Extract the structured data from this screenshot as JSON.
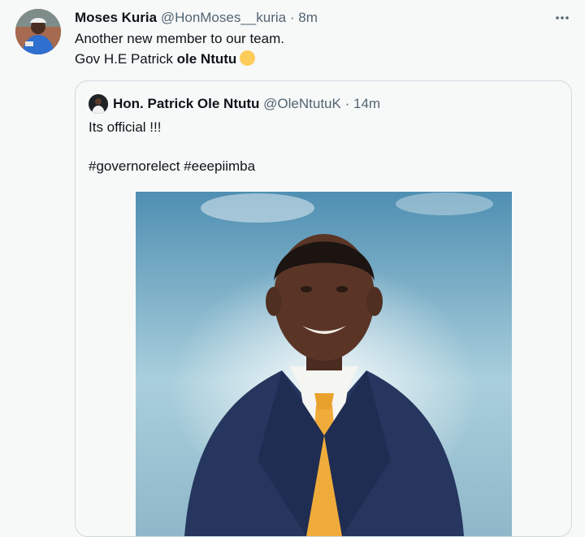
{
  "tweet": {
    "author_name": "Moses Kuria",
    "author_handle": "@HonMoses__kuria",
    "separator": "·",
    "time": "8m",
    "line1": "Another new member to our team.",
    "line2_prefix": "Gov H.E Patrick ",
    "line2_bold": "ole Ntutu",
    "emoji": "yellow-circle",
    "more_icon": "more-horizontal-icon"
  },
  "quoted": {
    "author_name": "Hon. Patrick Ole Ntutu",
    "author_handle": "@OleNtutuK",
    "separator": "·",
    "time": "14m",
    "text1": "Its official !!!",
    "text2": "#governorelect #eeepiimba"
  },
  "colors": {
    "background": "#f7f9f9",
    "text": "#0f1419",
    "muted": "#536471",
    "border": "#cfd9de"
  }
}
